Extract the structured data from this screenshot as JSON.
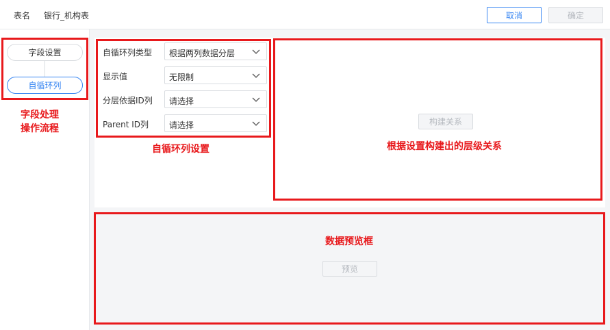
{
  "header": {
    "table_label": "表名",
    "table_name": "银行_机构表",
    "cancel_label": "取消",
    "confirm_label": "确定"
  },
  "steps": {
    "items": [
      {
        "label": "字段设置"
      },
      {
        "label": "自循环列"
      }
    ]
  },
  "config": {
    "rows": [
      {
        "label": "自循环列类型",
        "value": "根据两列数据分层"
      },
      {
        "label": "显示值",
        "value": "无限制"
      },
      {
        "label": "分层依据ID列",
        "value": "请选择"
      },
      {
        "label": "Parent ID列",
        "value": "请选择"
      }
    ]
  },
  "relation": {
    "build_label": "构建关系"
  },
  "preview": {
    "preview_label": "预览"
  },
  "annotations": {
    "flow_line1": "字段处理",
    "flow_line2": "操作流程",
    "config": "自循环列设置",
    "relation": "根据设置构建出的层级关系",
    "preview": "数据预览框"
  },
  "colors": {
    "accent": "#3685f2",
    "annotation_red": "#e8191c",
    "canvas_bg": "#f4f5f7"
  }
}
